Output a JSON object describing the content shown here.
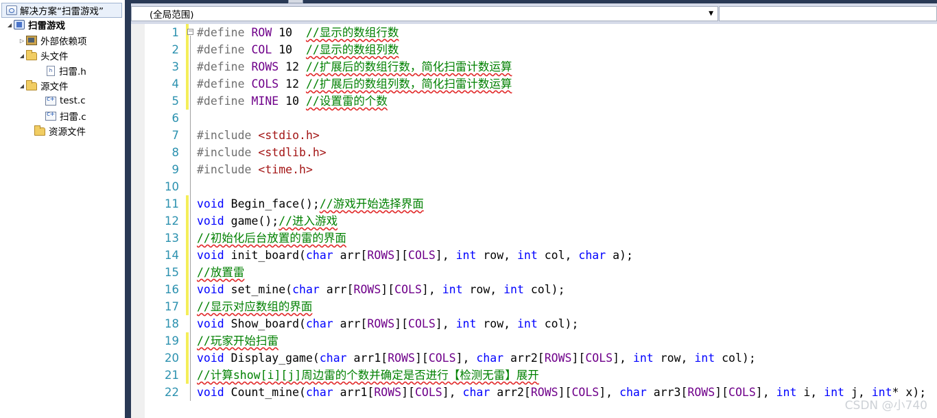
{
  "solution_explorer": {
    "title": "解决方案“扫雷游戏”",
    "project": "扫雷游戏",
    "items": [
      {
        "label": "外部依赖项",
        "icon": "dependency-icon"
      },
      {
        "label": "头文件",
        "icon": "folder-icon"
      },
      {
        "label": "扫雷.h",
        "icon": "header-file-icon"
      },
      {
        "label": "源文件",
        "icon": "folder-icon"
      },
      {
        "label": "test.c",
        "icon": "c-file-icon"
      },
      {
        "label": "扫雷.c",
        "icon": "c-file-icon"
      },
      {
        "label": "资源文件",
        "icon": "folder-icon"
      }
    ]
  },
  "editor": {
    "scope": "(全局范围)",
    "lines": [
      {
        "n": "1",
        "modified": true,
        "tokens": [
          [
            "pp",
            "#define "
          ],
          [
            "mac",
            "ROW"
          ],
          [
            "num",
            " 10  "
          ],
          [
            "cm",
            "//显示的数组行数"
          ]
        ]
      },
      {
        "n": "2",
        "modified": true,
        "tokens": [
          [
            "pp",
            "#define "
          ],
          [
            "mac",
            "COL"
          ],
          [
            "num",
            " 10  "
          ],
          [
            "cm",
            "//显示的数组列数"
          ]
        ]
      },
      {
        "n": "3",
        "modified": true,
        "tokens": [
          [
            "pp",
            "#define "
          ],
          [
            "mac",
            "ROWS"
          ],
          [
            "num",
            " 12 "
          ],
          [
            "cm",
            "//扩展后的数组行数，简化扫雷计数运算"
          ]
        ]
      },
      {
        "n": "4",
        "modified": true,
        "tokens": [
          [
            "pp",
            "#define "
          ],
          [
            "mac",
            "COLS"
          ],
          [
            "num",
            " 12 "
          ],
          [
            "cm",
            "//扩展后的数组列数，简化扫雷计数运算"
          ]
        ]
      },
      {
        "n": "5",
        "modified": true,
        "tokens": [
          [
            "pp",
            "#define "
          ],
          [
            "mac",
            "MINE"
          ],
          [
            "num",
            " 10 "
          ],
          [
            "cm",
            "//设置雷的个数"
          ]
        ]
      },
      {
        "n": "6",
        "modified": false,
        "tokens": []
      },
      {
        "n": "7",
        "modified": false,
        "tokens": [
          [
            "pp",
            "#include "
          ],
          [
            "str",
            "<stdio.h>"
          ]
        ]
      },
      {
        "n": "8",
        "modified": false,
        "tokens": [
          [
            "pp",
            "#include "
          ],
          [
            "str",
            "<stdlib.h>"
          ]
        ]
      },
      {
        "n": "9",
        "modified": false,
        "tokens": [
          [
            "pp",
            "#include "
          ],
          [
            "str",
            "<time.h>"
          ]
        ]
      },
      {
        "n": "10",
        "modified": false,
        "tokens": []
      },
      {
        "n": "11",
        "modified": true,
        "tokens": [
          [
            "kw",
            "void"
          ],
          [
            "fn",
            " Begin_face();"
          ],
          [
            "cm",
            "//游戏开始选择界面"
          ]
        ]
      },
      {
        "n": "12",
        "modified": true,
        "tokens": [
          [
            "kw",
            "void"
          ],
          [
            "fn",
            " game();"
          ],
          [
            "cm",
            "//进入游戏"
          ]
        ]
      },
      {
        "n": "13",
        "modified": true,
        "tokens": [
          [
            "cm",
            "//初始化后台放置的雷的界面"
          ]
        ]
      },
      {
        "n": "14",
        "modified": true,
        "tokens": [
          [
            "kw",
            "void"
          ],
          [
            "fn",
            " init_board("
          ],
          [
            "kw",
            "char"
          ],
          [
            "fn",
            " arr["
          ],
          [
            "mac",
            "ROWS"
          ],
          [
            "fn",
            "]["
          ],
          [
            "mac",
            "COLS"
          ],
          [
            "fn",
            "], "
          ],
          [
            "kw",
            "int"
          ],
          [
            "fn",
            " row, "
          ],
          [
            "kw",
            "int"
          ],
          [
            "fn",
            " col, "
          ],
          [
            "kw",
            "char"
          ],
          [
            "fn",
            " a);"
          ]
        ]
      },
      {
        "n": "15",
        "modified": true,
        "tokens": [
          [
            "cm",
            "//放置雷"
          ]
        ]
      },
      {
        "n": "16",
        "modified": true,
        "tokens": [
          [
            "kw",
            "void"
          ],
          [
            "fn",
            " set_mine("
          ],
          [
            "kw",
            "char"
          ],
          [
            "fn",
            " arr["
          ],
          [
            "mac",
            "ROWS"
          ],
          [
            "fn",
            "]["
          ],
          [
            "mac",
            "COLS"
          ],
          [
            "fn",
            "], "
          ],
          [
            "kw",
            "int"
          ],
          [
            "fn",
            " row, "
          ],
          [
            "kw",
            "int"
          ],
          [
            "fn",
            " col);"
          ]
        ]
      },
      {
        "n": "17",
        "modified": true,
        "tokens": [
          [
            "cm",
            "//显示对应数组的界面"
          ]
        ]
      },
      {
        "n": "18",
        "modified": false,
        "tokens": [
          [
            "kw",
            "void"
          ],
          [
            "fn",
            " Show_board("
          ],
          [
            "kw",
            "char"
          ],
          [
            "fn",
            " arr["
          ],
          [
            "mac",
            "ROWS"
          ],
          [
            "fn",
            "]["
          ],
          [
            "mac",
            "COLS"
          ],
          [
            "fn",
            "], "
          ],
          [
            "kw",
            "int"
          ],
          [
            "fn",
            " row, "
          ],
          [
            "kw",
            "int"
          ],
          [
            "fn",
            " col);"
          ]
        ]
      },
      {
        "n": "19",
        "modified": true,
        "tokens": [
          [
            "cm",
            "//玩家开始扫雷"
          ]
        ]
      },
      {
        "n": "20",
        "modified": true,
        "tokens": [
          [
            "kw",
            "void"
          ],
          [
            "fn",
            " Display_game("
          ],
          [
            "kw",
            "char"
          ],
          [
            "fn",
            " arr1["
          ],
          [
            "mac",
            "ROWS"
          ],
          [
            "fn",
            "]["
          ],
          [
            "mac",
            "COLS"
          ],
          [
            "fn",
            "], "
          ],
          [
            "kw",
            "char"
          ],
          [
            "fn",
            " arr2["
          ],
          [
            "mac",
            "ROWS"
          ],
          [
            "fn",
            "]["
          ],
          [
            "mac",
            "COLS"
          ],
          [
            "fn",
            "], "
          ],
          [
            "kw",
            "int"
          ],
          [
            "fn",
            " row, "
          ],
          [
            "kw",
            "int"
          ],
          [
            "fn",
            " col);"
          ]
        ]
      },
      {
        "n": "21",
        "modified": true,
        "tokens": [
          [
            "cm",
            "//计算show[i][j]周边雷的个数并确定是否进行【检测无雷】展开"
          ]
        ]
      },
      {
        "n": "22",
        "modified": false,
        "tokens": [
          [
            "kw",
            "void"
          ],
          [
            "fn",
            " Count_mine("
          ],
          [
            "kw",
            "char"
          ],
          [
            "fn",
            " arr1["
          ],
          [
            "mac",
            "ROWS"
          ],
          [
            "fn",
            "]["
          ],
          [
            "mac",
            "COLS"
          ],
          [
            "fn",
            "], "
          ],
          [
            "kw",
            "char"
          ],
          [
            "fn",
            " arr2["
          ],
          [
            "mac",
            "ROWS"
          ],
          [
            "fn",
            "]["
          ],
          [
            "mac",
            "COLS"
          ],
          [
            "fn",
            "], "
          ],
          [
            "kw",
            "char"
          ],
          [
            "fn",
            " arr3["
          ],
          [
            "mac",
            "ROWS"
          ],
          [
            "fn",
            "]["
          ],
          [
            "mac",
            "COLS"
          ],
          [
            "fn",
            "], "
          ],
          [
            "kw",
            "int"
          ],
          [
            "fn",
            " i, "
          ],
          [
            "kw",
            "int"
          ],
          [
            "fn",
            " j, "
          ],
          [
            "kw",
            "int"
          ],
          [
            "fn",
            "* x);"
          ]
        ]
      }
    ]
  },
  "watermark": "CSDN @小740",
  "colors": {
    "keyword": "#0000ff",
    "macro": "#6f008a",
    "comment": "#008000",
    "string": "#a31515",
    "line_number": "#2b91af",
    "change_bar": "#f4ee5a"
  }
}
